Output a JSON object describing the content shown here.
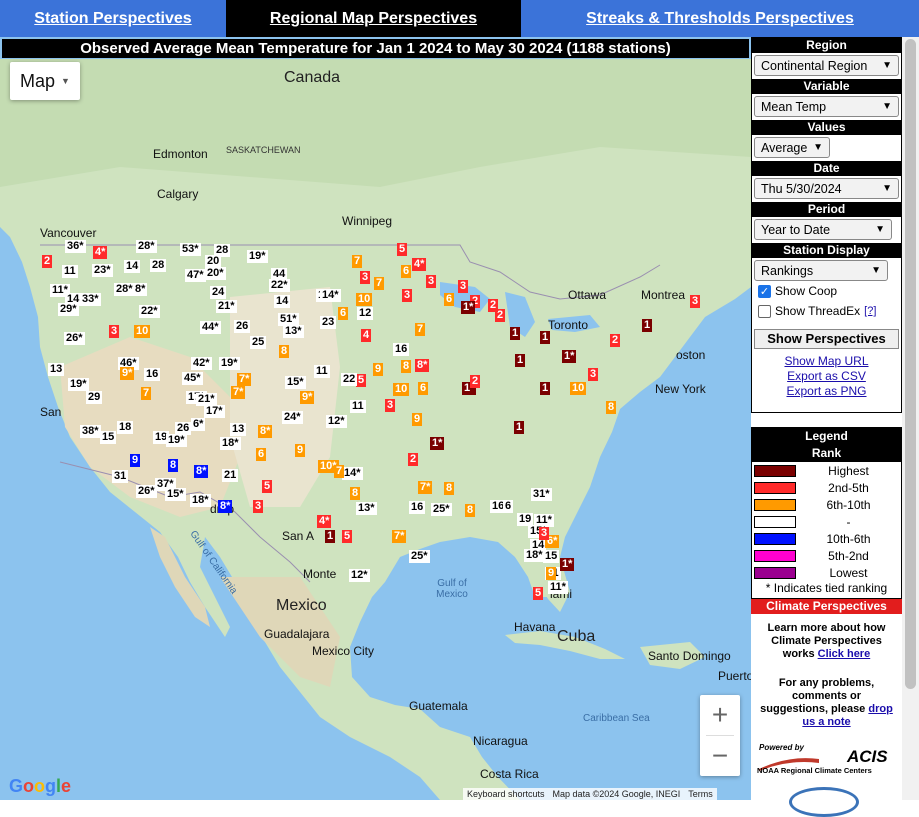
{
  "nav": {
    "station": "Station Perspectives",
    "regional": "Regional Map Perspectives",
    "streaks": "Streaks & Thresholds Perspectives"
  },
  "map": {
    "title": "Observed Average Mean Temperature for Jan 1 2024 to May 30 2024 (1188 stations)",
    "type_label": "Map",
    "zoom_in": "+",
    "zoom_out": "−",
    "attribution": {
      "shortcuts": "Keyboard shortcuts",
      "data": "Map data ©2024 Google, INEGI",
      "terms": "Terms"
    },
    "labels": {
      "canada": "Canada",
      "mexico": "Mexico",
      "cuba": "Cuba",
      "guatemala": "Guatemala",
      "nicaragua": "Nicaragua",
      "costa_rica": "Costa Rica",
      "edmonton": "Edmonton",
      "saskatchewan": "SASKATCHEWAN",
      "winnipeg": "Winnipeg",
      "vancouver": "Vancouver",
      "calgary": "Calgary",
      "ottawa": "Ottawa",
      "montreal": "Montrea",
      "toronto": "Toronto",
      "boston": "oston",
      "new_york": "New York",
      "monterrey": "Monte",
      "guadalajara": "Guadalajara",
      "mexico_city": "Mexico City",
      "havana": "Havana",
      "santo_domingo": "Santo Domingo",
      "puerto_rico": "Puerto",
      "miami": "iami",
      "gulf_mexico": "Gulf of Mexico",
      "gulf_california": "Gulf of California",
      "caribbean_sea": "Caribbean Sea",
      "san_a": "San A",
      "san": "San",
      "drop": "drop"
    },
    "markers": [
      {
        "t": "36*",
        "c": "m-mid"
      },
      {
        "t": "4*",
        "c": "m-top5"
      },
      {
        "t": "28*",
        "c": "m-mid"
      },
      {
        "t": "53*",
        "c": "m-mid"
      },
      {
        "t": "28",
        "c": "m-mid"
      },
      {
        "t": "19*",
        "c": "m-mid"
      },
      {
        "t": "2",
        "c": "m-top5"
      },
      {
        "t": "11",
        "c": "m-mid"
      },
      {
        "t": "23*",
        "c": "m-mid"
      },
      {
        "t": "14",
        "c": "m-mid"
      },
      {
        "t": "28",
        "c": "m-mid"
      },
      {
        "t": "20",
        "c": "m-mid"
      },
      {
        "t": "44",
        "c": "m-mid"
      },
      {
        "t": "7",
        "c": "m-top10"
      },
      {
        "t": "5",
        "c": "m-top5"
      },
      {
        "t": "4*",
        "c": "m-top5"
      },
      {
        "t": "11*",
        "c": "m-mid"
      },
      {
        "t": "28*",
        "c": "m-mid"
      },
      {
        "t": "47*",
        "c": "m-mid"
      },
      {
        "t": "20*",
        "c": "m-mid"
      },
      {
        "t": "22*",
        "c": "m-mid"
      },
      {
        "t": "7",
        "c": "m-top10"
      },
      {
        "t": "3",
        "c": "m-top5"
      },
      {
        "t": "6",
        "c": "m-top10"
      },
      {
        "t": "3",
        "c": "m-top5"
      },
      {
        "t": "14",
        "c": "m-mid"
      },
      {
        "t": "33*",
        "c": "m-mid"
      },
      {
        "t": "8*",
        "c": "m-mid"
      },
      {
        "t": "24",
        "c": "m-mid"
      },
      {
        "t": "14",
        "c": "m-mid"
      },
      {
        "t": "13",
        "c": "m-mid"
      },
      {
        "t": "14*",
        "c": "m-mid"
      },
      {
        "t": "6",
        "c": "m-top10"
      },
      {
        "t": "10",
        "c": "m-top10"
      },
      {
        "t": "3",
        "c": "m-top5"
      },
      {
        "t": "6",
        "c": "m-top10"
      },
      {
        "t": "3",
        "c": "m-top5"
      },
      {
        "t": "2",
        "c": "m-top5"
      },
      {
        "t": "29*",
        "c": "m-mid"
      },
      {
        "t": "22*",
        "c": "m-mid"
      },
      {
        "t": "21*",
        "c": "m-mid"
      },
      {
        "t": "51*",
        "c": "m-mid"
      },
      {
        "t": "12",
        "c": "m-mid"
      },
      {
        "t": "1*",
        "c": "m-high"
      },
      {
        "t": "2",
        "c": "m-top5"
      },
      {
        "t": "2",
        "c": "m-top5"
      },
      {
        "t": "2",
        "c": "m-top5"
      },
      {
        "t": "1",
        "c": "m-high"
      },
      {
        "t": "3",
        "c": "m-top5"
      },
      {
        "t": "10",
        "c": "m-top10"
      },
      {
        "t": "44*",
        "c": "m-mid"
      },
      {
        "t": "26",
        "c": "m-mid"
      },
      {
        "t": "23",
        "c": "m-mid"
      },
      {
        "t": "13*",
        "c": "m-mid"
      },
      {
        "t": "3",
        "c": "m-top5"
      },
      {
        "t": "4",
        "c": "m-top5"
      },
      {
        "t": "1",
        "c": "m-high"
      },
      {
        "t": "26*",
        "c": "m-mid"
      },
      {
        "t": "25",
        "c": "m-mid"
      },
      {
        "t": "8",
        "c": "m-top10"
      },
      {
        "t": "16",
        "c": "m-mid"
      },
      {
        "t": "7",
        "c": "m-top10"
      },
      {
        "t": "13",
        "c": "m-mid"
      },
      {
        "t": "46*",
        "c": "m-mid"
      },
      {
        "t": "42*",
        "c": "m-mid"
      },
      {
        "t": "19*",
        "c": "m-mid"
      },
      {
        "t": "8",
        "c": "m-top10"
      },
      {
        "t": "8*",
        "c": "m-top5"
      },
      {
        "t": "1*",
        "c": "m-high"
      },
      {
        "t": "5",
        "c": "m-top5"
      },
      {
        "t": "9*",
        "c": "m-top10"
      },
      {
        "t": "16",
        "c": "m-mid"
      },
      {
        "t": "45*",
        "c": "m-mid"
      },
      {
        "t": "7*",
        "c": "m-top10"
      },
      {
        "t": "15*",
        "c": "m-mid"
      },
      {
        "t": "11",
        "c": "m-mid"
      },
      {
        "t": "22",
        "c": "m-mid"
      },
      {
        "t": "9",
        "c": "m-top10"
      },
      {
        "t": "1",
        "c": "m-high"
      },
      {
        "t": "1",
        "c": "m-high"
      },
      {
        "t": "1*",
        "c": "m-high"
      },
      {
        "t": "3",
        "c": "m-top5"
      },
      {
        "t": "19*",
        "c": "m-mid"
      },
      {
        "t": "10",
        "c": "m-top10"
      },
      {
        "t": "6",
        "c": "m-top10"
      },
      {
        "t": "2",
        "c": "m-top5"
      },
      {
        "t": "1",
        "c": "m-high"
      },
      {
        "t": "10",
        "c": "m-top10"
      },
      {
        "t": "29",
        "c": "m-mid"
      },
      {
        "t": "7",
        "c": "m-top10"
      },
      {
        "t": "17*",
        "c": "m-mid"
      },
      {
        "t": "7*",
        "c": "m-top10"
      },
      {
        "t": "21*",
        "c": "m-mid"
      },
      {
        "t": "9*",
        "c": "m-top10"
      },
      {
        "t": "11",
        "c": "m-mid"
      },
      {
        "t": "3",
        "c": "m-top5"
      },
      {
        "t": "1",
        "c": "m-high"
      },
      {
        "t": "8",
        "c": "m-top10"
      },
      {
        "t": "17*",
        "c": "m-mid"
      },
      {
        "t": "24*",
        "c": "m-mid"
      },
      {
        "t": "12*",
        "c": "m-mid"
      },
      {
        "t": "9",
        "c": "m-top10"
      },
      {
        "t": "38*",
        "c": "m-mid"
      },
      {
        "t": "18",
        "c": "m-mid"
      },
      {
        "t": "26",
        "c": "m-mid"
      },
      {
        "t": "6*",
        "c": "m-mid"
      },
      {
        "t": "13",
        "c": "m-mid"
      },
      {
        "t": "8*",
        "c": "m-top10"
      },
      {
        "t": "18*",
        "c": "m-mid"
      },
      {
        "t": "1*",
        "c": "m-high"
      },
      {
        "t": "15",
        "c": "m-mid"
      },
      {
        "t": "19",
        "c": "m-mid"
      },
      {
        "t": "19*",
        "c": "m-mid"
      },
      {
        "t": "6",
        "c": "m-top10"
      },
      {
        "t": "9",
        "c": "m-top10"
      },
      {
        "t": "2",
        "c": "m-top5"
      },
      {
        "t": "10*",
        "c": "m-top10"
      },
      {
        "t": "14*",
        "c": "m-mid"
      },
      {
        "t": "9",
        "c": "m-low10"
      },
      {
        "t": "8",
        "c": "m-low10"
      },
      {
        "t": "8*",
        "c": "m-low10"
      },
      {
        "t": "21",
        "c": "m-mid"
      },
      {
        "t": "31",
        "c": "m-mid"
      },
      {
        "t": "37*",
        "c": "m-mid"
      },
      {
        "t": "5",
        "c": "m-top5"
      },
      {
        "t": "7",
        "c": "m-top10"
      },
      {
        "t": "8",
        "c": "m-top10"
      },
      {
        "t": "7*",
        "c": "m-top10"
      },
      {
        "t": "8",
        "c": "m-top10"
      },
      {
        "t": "31*",
        "c": "m-mid"
      },
      {
        "t": "26*",
        "c": "m-mid"
      },
      {
        "t": "15*",
        "c": "m-mid"
      },
      {
        "t": "18*",
        "c": "m-mid"
      },
      {
        "t": "8*",
        "c": "m-low10"
      },
      {
        "t": "3",
        "c": "m-top5"
      },
      {
        "t": "13*",
        "c": "m-mid"
      },
      {
        "t": "16",
        "c": "m-mid"
      },
      {
        "t": "25*",
        "c": "m-mid"
      },
      {
        "t": "8",
        "c": "m-top10"
      },
      {
        "t": "16*",
        "c": "m-mid"
      },
      {
        "t": "6",
        "c": "m-mid"
      },
      {
        "t": "19",
        "c": "m-mid"
      },
      {
        "t": "11*",
        "c": "m-mid"
      },
      {
        "t": "4*",
        "c": "m-top5"
      },
      {
        "t": "1",
        "c": "m-high"
      },
      {
        "t": "5",
        "c": "m-top5"
      },
      {
        "t": "7*",
        "c": "m-top10"
      },
      {
        "t": "25*",
        "c": "m-mid"
      },
      {
        "t": "14",
        "c": "m-mid"
      },
      {
        "t": "6*",
        "c": "m-top10"
      },
      {
        "t": "18*",
        "c": "m-mid"
      },
      {
        "t": "15",
        "c": "m-mid"
      },
      {
        "t": "11",
        "c": "m-mid"
      },
      {
        "t": "11*",
        "c": "m-mid"
      },
      {
        "t": "5",
        "c": "m-top5"
      },
      {
        "t": "12*",
        "c": "m-mid"
      },
      {
        "t": "15*",
        "c": "m-mid"
      },
      {
        "t": "9",
        "c": "m-top10"
      },
      {
        "t": "1*",
        "c": "m-high"
      },
      {
        "t": "3",
        "c": "m-top5"
      }
    ]
  },
  "sidebar": {
    "region": {
      "head": "Region",
      "value": "Continental Region"
    },
    "variable": {
      "head": "Variable",
      "value": "Mean Temp"
    },
    "values": {
      "head": "Values",
      "value": "Average"
    },
    "date": {
      "head": "Date",
      "value": "Thu 5/30/2024"
    },
    "period": {
      "head": "Period",
      "value": "Year to Date"
    },
    "station_display": {
      "head": "Station Display",
      "value": "Rankings",
      "show_coop": "Show Coop",
      "show_threadex": "Show ThreadEx",
      "help": "[?]"
    },
    "show_perspectives": "Show Perspectives",
    "links": {
      "map_url": "Show Map URL",
      "csv": "Export as CSV",
      "png": "Export as PNG"
    },
    "legend": {
      "head": "Legend",
      "subhead": "Rank",
      "items": [
        {
          "label": "Highest",
          "color": "#7a0000"
        },
        {
          "label": "2nd-5th",
          "color": "#ff2a2a"
        },
        {
          "label": "6th-10th",
          "color": "#ff9a00"
        },
        {
          "label": "-",
          "color": "#ffffff"
        },
        {
          "label": "10th-6th",
          "color": "#0011ff"
        },
        {
          "label": "5th-2nd",
          "color": "#ff00d0"
        },
        {
          "label": "Lowest",
          "color": "#9b0090"
        }
      ],
      "note": "* Indicates tied ranking"
    },
    "cp": {
      "head": "Climate Perspectives",
      "learn": "Learn more about how Climate Perspectives works",
      "click_here": "Click here",
      "problems": "For any problems, comments or suggestions, please",
      "drop_note": "drop us a note"
    },
    "acis": {
      "powered": "Powered by",
      "name": "ACIS",
      "rcc": "NOAA Regional Climate Centers"
    }
  },
  "colors": {
    "nav_blue": "#3b73d9",
    "rank_highest": "#7a0000",
    "rank_top5": "#ff2a2a",
    "rank_top10": "#ff9a00",
    "rank_low10": "#0011ff",
    "rank_low5": "#ff00d0",
    "cp_red": "#e21d1d"
  }
}
